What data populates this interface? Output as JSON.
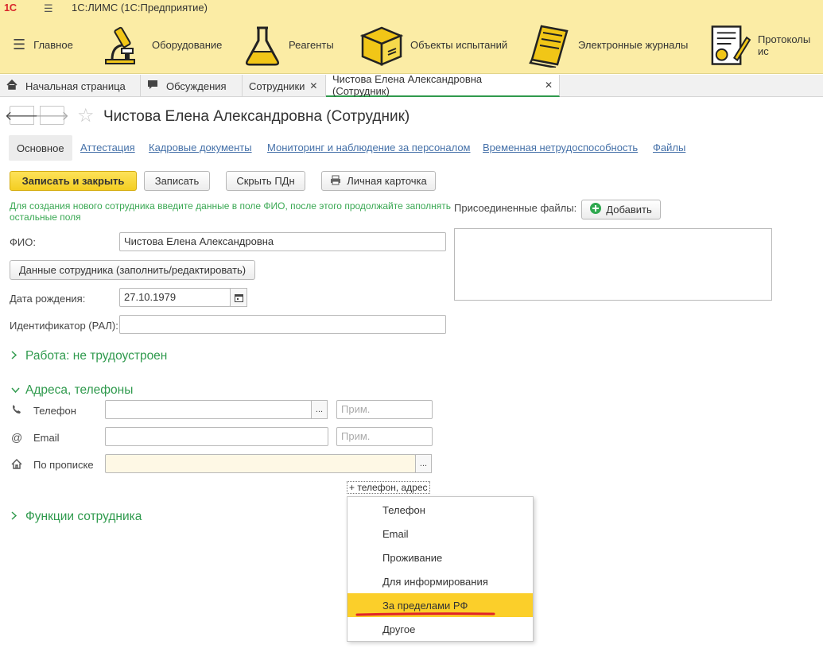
{
  "app": {
    "logo": "1С",
    "title": "1С:ЛИМС  (1С:Предприятие)"
  },
  "sections": [
    {
      "label": "Главное",
      "icon": "hamburger-icon"
    },
    {
      "label": "Оборудование",
      "icon": "microscope-icon"
    },
    {
      "label": "Реагенты",
      "icon": "flask-icon"
    },
    {
      "label": "Объекты испытаний",
      "icon": "box-icon"
    },
    {
      "label": "Электронные журналы",
      "icon": "journal-icon"
    },
    {
      "label": "Протоколы ис",
      "icon": "protocol-icon"
    }
  ],
  "tabs": [
    {
      "label": "Начальная страница",
      "icon": "home-icon"
    },
    {
      "label": "Обсуждения",
      "icon": "chat-icon"
    },
    {
      "label": "Сотрудники",
      "close": "✕"
    },
    {
      "label": "Чистова Елена Александровна (Сотрудник)",
      "close": "✕"
    }
  ],
  "header": {
    "back": "🡐",
    "forward": "🡒",
    "star": "☆",
    "title": "Чистова Елена Александровна (Сотрудник)"
  },
  "subtabs": [
    "Основное",
    "Аттестация",
    "Кадровые документы",
    "Мониторинг и наблюдение за персоналом",
    "Временная нетрудоспособность",
    "Файлы"
  ],
  "buttons": {
    "save_close": "Записать и закрыть",
    "save": "Записать",
    "hide_pd": "Скрыть ПДн",
    "card": "Личная карточка",
    "employee_data": "Данные сотрудника (заполнить/редактировать)",
    "add": "Добавить"
  },
  "hint": "Для создания нового сотрудника введите данные в поле ФИО, после этого продолжайте заполнять остальные поля",
  "fields": {
    "fio_label": "ФИО:",
    "fio_value": "Чистова Елена Александровна",
    "birth_label": "Дата рождения:",
    "birth_value": "27.10.1979",
    "ral_label": "Идентификатор (РАЛ):",
    "ral_value": ""
  },
  "files": {
    "label": "Присоединенные файлы:"
  },
  "groups": {
    "work": "Работа: не трудоустроен",
    "contacts": "Адреса, телефоны",
    "functions": "Функции сотрудника"
  },
  "contacts": {
    "phone_label": "Телефон",
    "email_label": "Email",
    "reg_label": "По прописке",
    "note_placeholder": "Прим.",
    "ellipsis": "...",
    "add_link": "+ телефон, адрес"
  },
  "popup": {
    "items": [
      "Телефон",
      "Email",
      "Проживание",
      "Для информирования",
      "За пределами РФ",
      "Другое"
    ],
    "highlighted": "За пределами РФ"
  }
}
